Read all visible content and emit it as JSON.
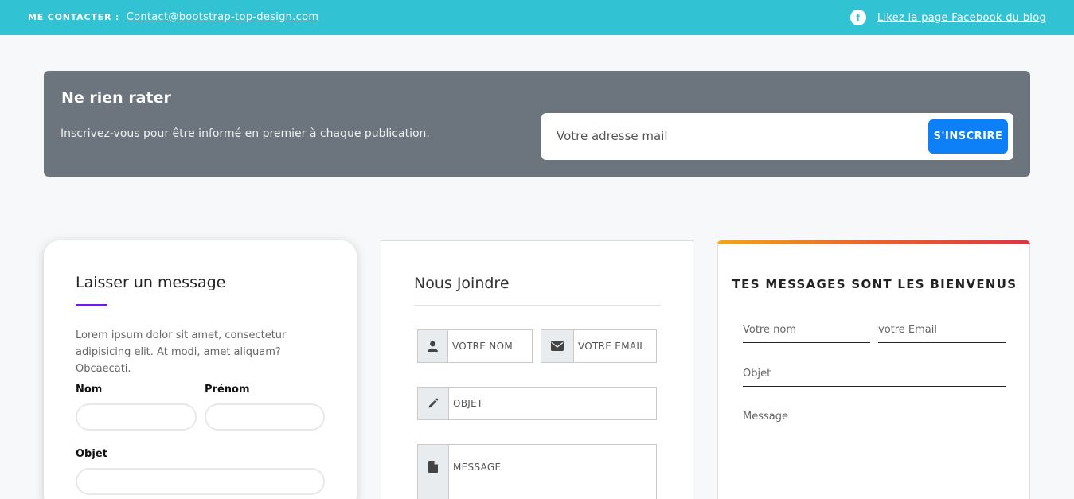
{
  "topbar": {
    "contact_label": "ME CONTACTER :",
    "contact_email": "Contact@bootstrap-top-design.com",
    "facebook_icon": "facebook-icon",
    "facebook_link": "Likez la page Facebook du blog"
  },
  "newsletter": {
    "title": "Ne rien rater",
    "subtitle": "Inscrivez-vous pour être informé en premier à chaque publication.",
    "email_placeholder": "Votre adresse mail",
    "subscribe_label": "S'INSCRIRE",
    "background_color": "#6c757d",
    "button_color": "#0d7ff7"
  },
  "card1": {
    "title": "Laisser un message",
    "description": "Lorem ipsum dolor sit amet, consectetur adipisicing elit. At modi, amet aliquam? Obcaecati.",
    "nom_label": "Nom",
    "prenom_label": "Prénom",
    "objet_label": "Objet",
    "accent_color": "#6a1ee0"
  },
  "card2": {
    "title": "Nous Joindre",
    "name_placeholder": "VOTRE NOM",
    "email_placeholder": "VOTRE EMAIL",
    "subject_placeholder": "OBJET",
    "message_placeholder": "MESSAGE",
    "icons": [
      "user-icon",
      "envelope-icon",
      "pencil-icon",
      "file-icon"
    ]
  },
  "card3": {
    "title": "TES MESSAGES SONT LES BIENVENUS",
    "name_placeholder": "Votre nom",
    "email_placeholder": "votre Email",
    "subject_placeholder": "Objet",
    "message_placeholder": "Message",
    "gradient_colors": [
      "#f0a61a",
      "#e9622d",
      "#dc3545"
    ]
  }
}
